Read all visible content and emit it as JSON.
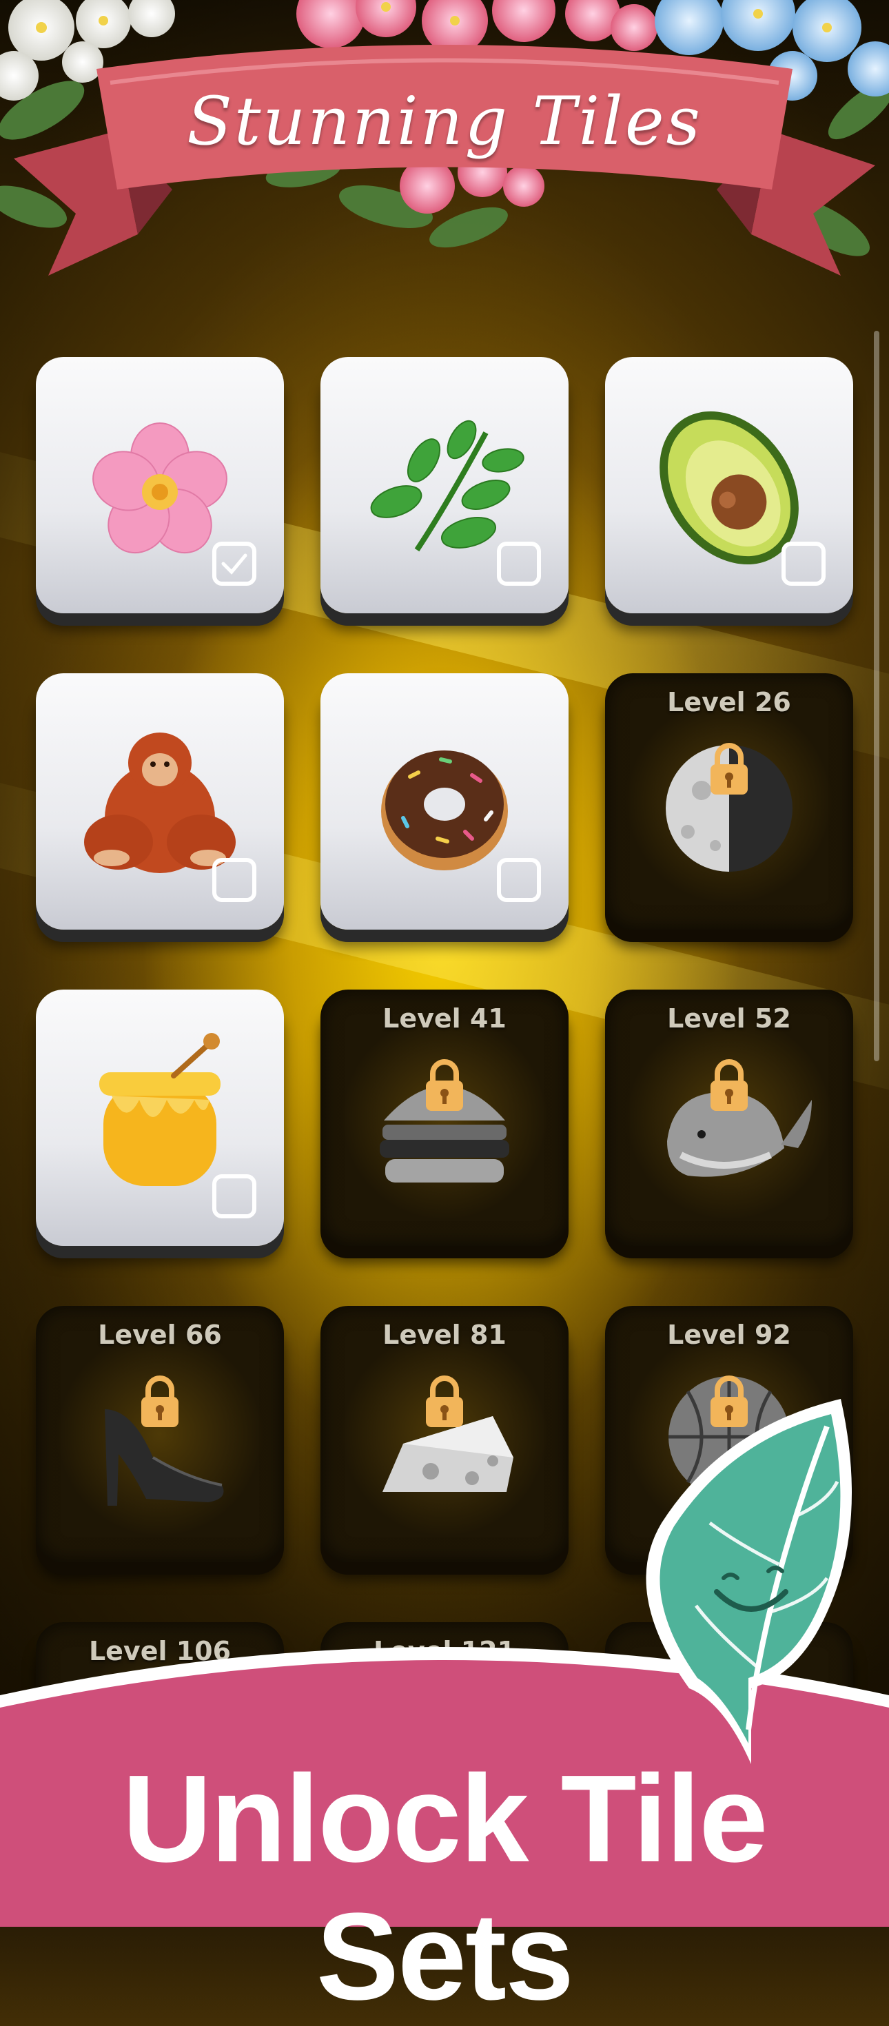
{
  "header": {
    "title": "Stunning Tiles"
  },
  "tiles": [
    {
      "icon": "cherry-blossom-icon",
      "checked": true
    },
    {
      "icon": "herb-icon",
      "checked": false
    },
    {
      "icon": "avocado-icon",
      "checked": false
    },
    {
      "icon": "orangutan-icon",
      "checked": false
    },
    {
      "icon": "doughnut-icon",
      "checked": false
    },
    {
      "icon": "moon-icon",
      "level": "Level 26"
    },
    {
      "icon": "honey-pot-icon",
      "checked": false
    },
    {
      "icon": "hamburger-icon",
      "level": "Level 41"
    },
    {
      "icon": "whale-icon",
      "level": "Level 52"
    },
    {
      "icon": "high-heel-icon",
      "level": "Level 66"
    },
    {
      "icon": "cheese-icon",
      "level": "Level 81"
    },
    {
      "icon": "basketball-icon",
      "level": "Level 92"
    },
    {
      "level": "Level 106"
    },
    {
      "level": "Level 121"
    }
  ],
  "footer": {
    "title": "Unlock Tile Sets"
  },
  "colors": {
    "banner": "#d9606a",
    "footer": "#cf4f7a",
    "leaf": "#4fb39a"
  }
}
